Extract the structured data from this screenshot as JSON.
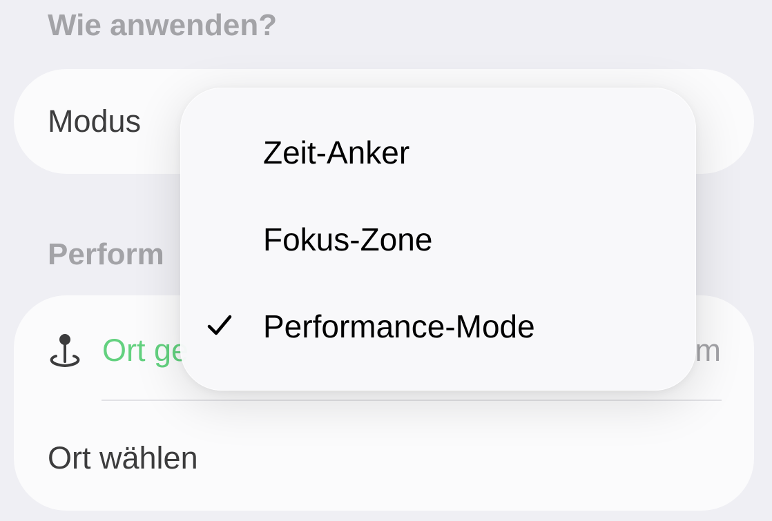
{
  "sections": {
    "apply_header": "Wie anwenden?",
    "performance_header": "Perform"
  },
  "mode_row": {
    "label": "Modus"
  },
  "place_card": {
    "current_location_label": "Ort ge",
    "current_location_icon": "location-pin-icon",
    "current_location_value": "m",
    "choose_place_label": "Ort wählen"
  },
  "mode_menu": {
    "items": [
      {
        "label": "Zeit-Anker",
        "selected": false
      },
      {
        "label": "Fokus-Zone",
        "selected": false
      },
      {
        "label": "Performance-Mode",
        "selected": true
      }
    ],
    "check_icon": "checkmark-icon"
  },
  "colors": {
    "background": "#efeff4",
    "card": "#ffffff",
    "section_header": "#8a8a8e",
    "accent_green": "#34c759",
    "text": "#000000"
  }
}
